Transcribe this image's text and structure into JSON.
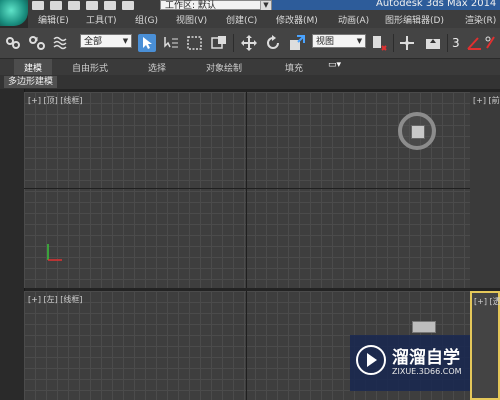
{
  "title_bar": {
    "workspace_label": "工作区: 默认",
    "app_title": "Autodesk 3ds Max  2014"
  },
  "menu": [
    {
      "label": "编辑(E)"
    },
    {
      "label": "工具(T)"
    },
    {
      "label": "组(G)"
    },
    {
      "label": "视图(V)"
    },
    {
      "label": "创建(C)"
    },
    {
      "label": "修改器(M)"
    },
    {
      "label": "动画(A)"
    },
    {
      "label": "图形编辑器(D)"
    },
    {
      "label": "渲染(R)"
    }
  ],
  "toolbar": {
    "selection_filter": "全部",
    "reference_coord": "视图",
    "snap_label": "3"
  },
  "ribbon": {
    "tabs": [
      "建模",
      "自由形式",
      "选择",
      "对象绘制",
      "填充"
    ],
    "subtab": "多边形建模"
  },
  "viewports": [
    {
      "label": "[+] [顶] [线框]"
    },
    {
      "label": "[+] [前]"
    },
    {
      "label": "[+] [左] [线框]"
    },
    {
      "label": "[+] [透]"
    }
  ],
  "watermark": {
    "title": "溜溜自学",
    "url": "ZIXUE.3D66.COM"
  }
}
